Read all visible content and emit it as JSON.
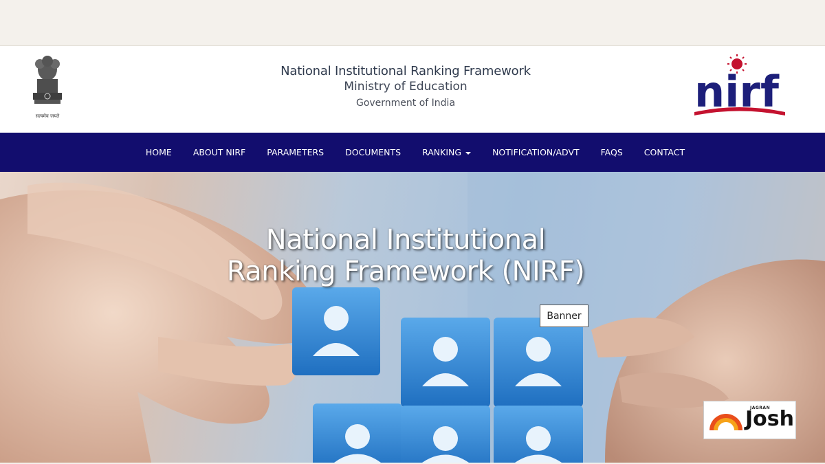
{
  "header": {
    "title": "National Institutional Ranking Framework",
    "ministry": "Ministry of Education",
    "government": "Government of India",
    "emblem_motto": "सत्यमेव जयते",
    "logo_text": "nirf"
  },
  "nav": {
    "items": [
      {
        "label": "HOME"
      },
      {
        "label": "ABOUT NIRF"
      },
      {
        "label": "PARAMETERS"
      },
      {
        "label": "DOCUMENTS"
      },
      {
        "label": "RANKING",
        "has_dropdown": true
      },
      {
        "label": "NOTIFICATION/ADVT"
      },
      {
        "label": "FAQS"
      },
      {
        "label": "CONTACT"
      }
    ],
    "background": "#120d6e"
  },
  "hero": {
    "title_line1": "National Institutional",
    "title_line2": "Ranking Framework (NIRF)",
    "tooltip": "Banner"
  },
  "watermark": {
    "small": "JAGRAN",
    "big": "Josh"
  },
  "colors": {
    "nav_bg": "#120d6e",
    "logo_blue": "#1d1f7a",
    "logo_red": "#c4122f",
    "cube_blue": "#2f86d6"
  }
}
